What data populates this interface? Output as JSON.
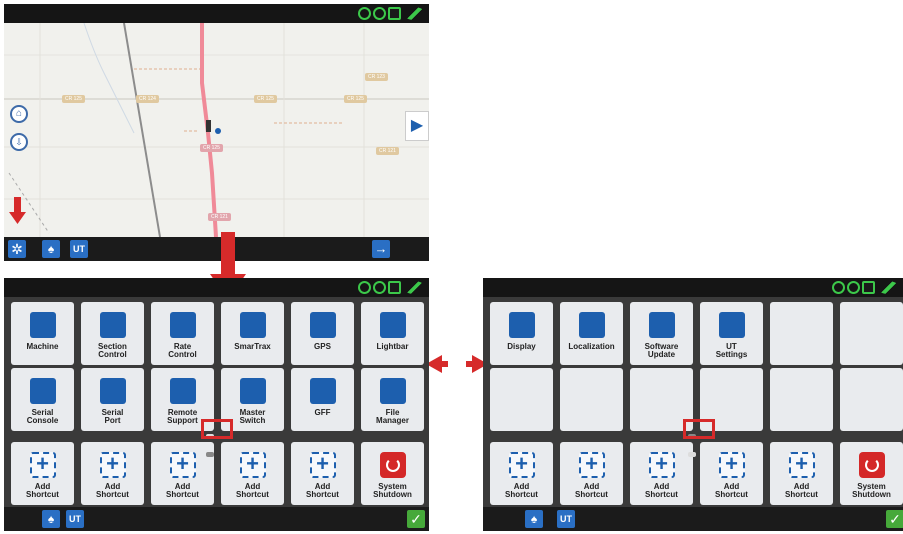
{
  "map_screen": {
    "road_labels": [
      "CR 125",
      "CR 124",
      "CR 125",
      "CR 125",
      "CR 123",
      "CR 125",
      "CR 121",
      "CR 121"
    ],
    "home_icon": "home-icon",
    "down_icon": "down-icon",
    "arrow_icon": "play-right-icon"
  },
  "menu_left": {
    "apps": [
      {
        "label": "Machine",
        "icon": "tractor-icon"
      },
      {
        "label": "Section\nControl",
        "icon": "section-control-icon"
      },
      {
        "label": "Rate\nControl",
        "icon": "rate-control-icon"
      },
      {
        "label": "SmarTrax",
        "icon": "steering-wheel-icon"
      },
      {
        "label": "GPS",
        "icon": "satellite-icon"
      },
      {
        "label": "Lightbar",
        "icon": "lightbar-icon"
      },
      {
        "label": "Serial\nConsole",
        "icon": "serial-console-icon"
      },
      {
        "label": "Serial\nPort",
        "icon": "serial-port-icon"
      },
      {
        "label": "Remote\nSupport",
        "icon": "remote-support-icon"
      },
      {
        "label": "Master\nSwitch",
        "icon": "master-switch-icon"
      },
      {
        "label": "GFF",
        "icon": "gff-icon"
      },
      {
        "label": "File\nManager",
        "icon": "file-manager-icon"
      }
    ],
    "shortcuts": [
      "Add\nShortcut",
      "Add\nShortcut",
      "Add\nShortcut",
      "Add\nShortcut",
      "Add\nShortcut"
    ],
    "shutdown": "System\nShutdown"
  },
  "menu_right": {
    "apps": [
      {
        "label": "Display",
        "icon": "display-icon"
      },
      {
        "label": "Localization",
        "icon": "globe-icon"
      },
      {
        "label": "Software\nUpdate",
        "icon": "software-update-icon"
      },
      {
        "label": "UT\nSettings",
        "icon": "ut-icon"
      }
    ],
    "shortcuts": [
      "Add\nShortcut",
      "Add\nShortcut",
      "Add\nShortcut",
      "Add\nShortcut",
      "Add\nShortcut"
    ],
    "shutdown": "System\nShutdown"
  },
  "colors": {
    "accent": "#1d5fae",
    "arrow": "#d62a2a",
    "status_green": "#3cc84a",
    "confirm": "#46a93a"
  }
}
